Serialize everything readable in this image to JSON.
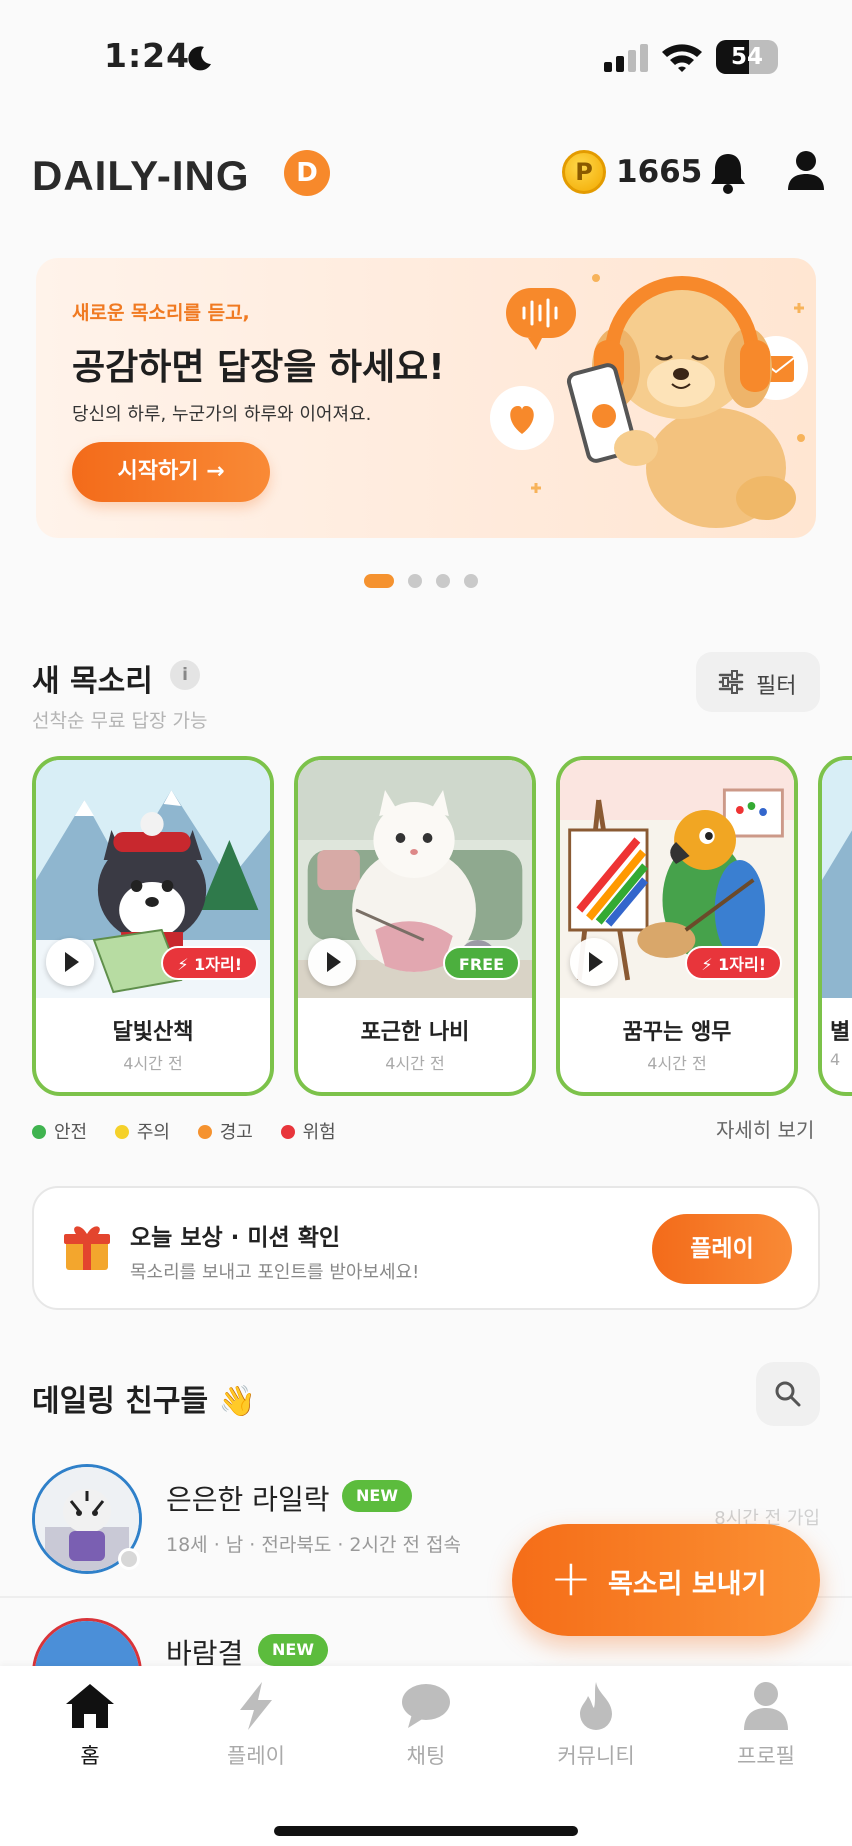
{
  "status_bar": {
    "time": "1:24",
    "battery": "54",
    "battery_level": 0.54
  },
  "header": {
    "logo": "DAILY-ING",
    "logo_badge": "D",
    "coin_symbol": "P",
    "coins": "1665",
    "bell_icon": "bell-icon",
    "user_icon": "user-icon"
  },
  "banner": {
    "subtitle": "새로운 목소리를 듣고,",
    "title": "공감하면 답장을 하세요!",
    "description": "당신의 하루, 누군가의 하루와 이어져요.",
    "cta": "시작하기 →",
    "page_count": 4,
    "active_page": 1
  },
  "new_voices": {
    "title": "새 목소리",
    "info_icon": "i",
    "subtitle": "선착순 무료 답장 가능",
    "filter_label": "필터",
    "cards": [
      {
        "name": "달빛산책",
        "time": "4시간 전",
        "tag": "⚡ 1자리!",
        "tag_type": "hot",
        "image": "husky-illustration"
      },
      {
        "name": "포근한 나비",
        "time": "4시간 전",
        "tag": "FREE",
        "tag_type": "free",
        "image": "cat-knitting-illustration"
      },
      {
        "name": "꿈꾸는 앵무",
        "time": "4시간 전",
        "tag": "⚡ 1자리!",
        "tag_type": "hot",
        "image": "parrot-painting-illustration"
      },
      {
        "name": "별",
        "time": "4",
        "tag": "",
        "tag_type": "",
        "image": "partial-card"
      }
    ],
    "legend": [
      {
        "label": "안전",
        "color": "#3fb34f"
      },
      {
        "label": "주의",
        "color": "#f5d12a"
      },
      {
        "label": "경고",
        "color": "#f5922f"
      },
      {
        "label": "위험",
        "color": "#e8353b"
      }
    ],
    "more_link": "자세히 보기"
  },
  "mission": {
    "title": "오늘 보상 · 미션 확인",
    "subtitle": "목소리를 보내고 포인트를 받아보세요!",
    "button": "플레이"
  },
  "friends": {
    "title": "데일링 친구들 👋",
    "items": [
      {
        "name": "은은한 라일락",
        "badge": "NEW",
        "info": "18세 · 남 · 전라북도 · 2시간 전 접속",
        "joined": "8시간 전 가입"
      },
      {
        "name": "바람결",
        "badge": "NEW",
        "info": "",
        "joined": ""
      }
    ]
  },
  "fab": {
    "plus": "+",
    "label": "목소리 보내기"
  },
  "tabs": [
    {
      "label": "홈",
      "icon": "home-icon",
      "active": true
    },
    {
      "label": "플레이",
      "icon": "lightning-icon",
      "active": false
    },
    {
      "label": "채팅",
      "icon": "chat-bubble-icon",
      "active": false
    },
    {
      "label": "커뮤니티",
      "icon": "flame-icon",
      "active": false
    },
    {
      "label": "프로필",
      "icon": "profile-icon",
      "active": false
    }
  ],
  "colors": {
    "accent": "#f5782a",
    "card_border": "#7cc24a",
    "new_badge": "#5cbc3d"
  }
}
